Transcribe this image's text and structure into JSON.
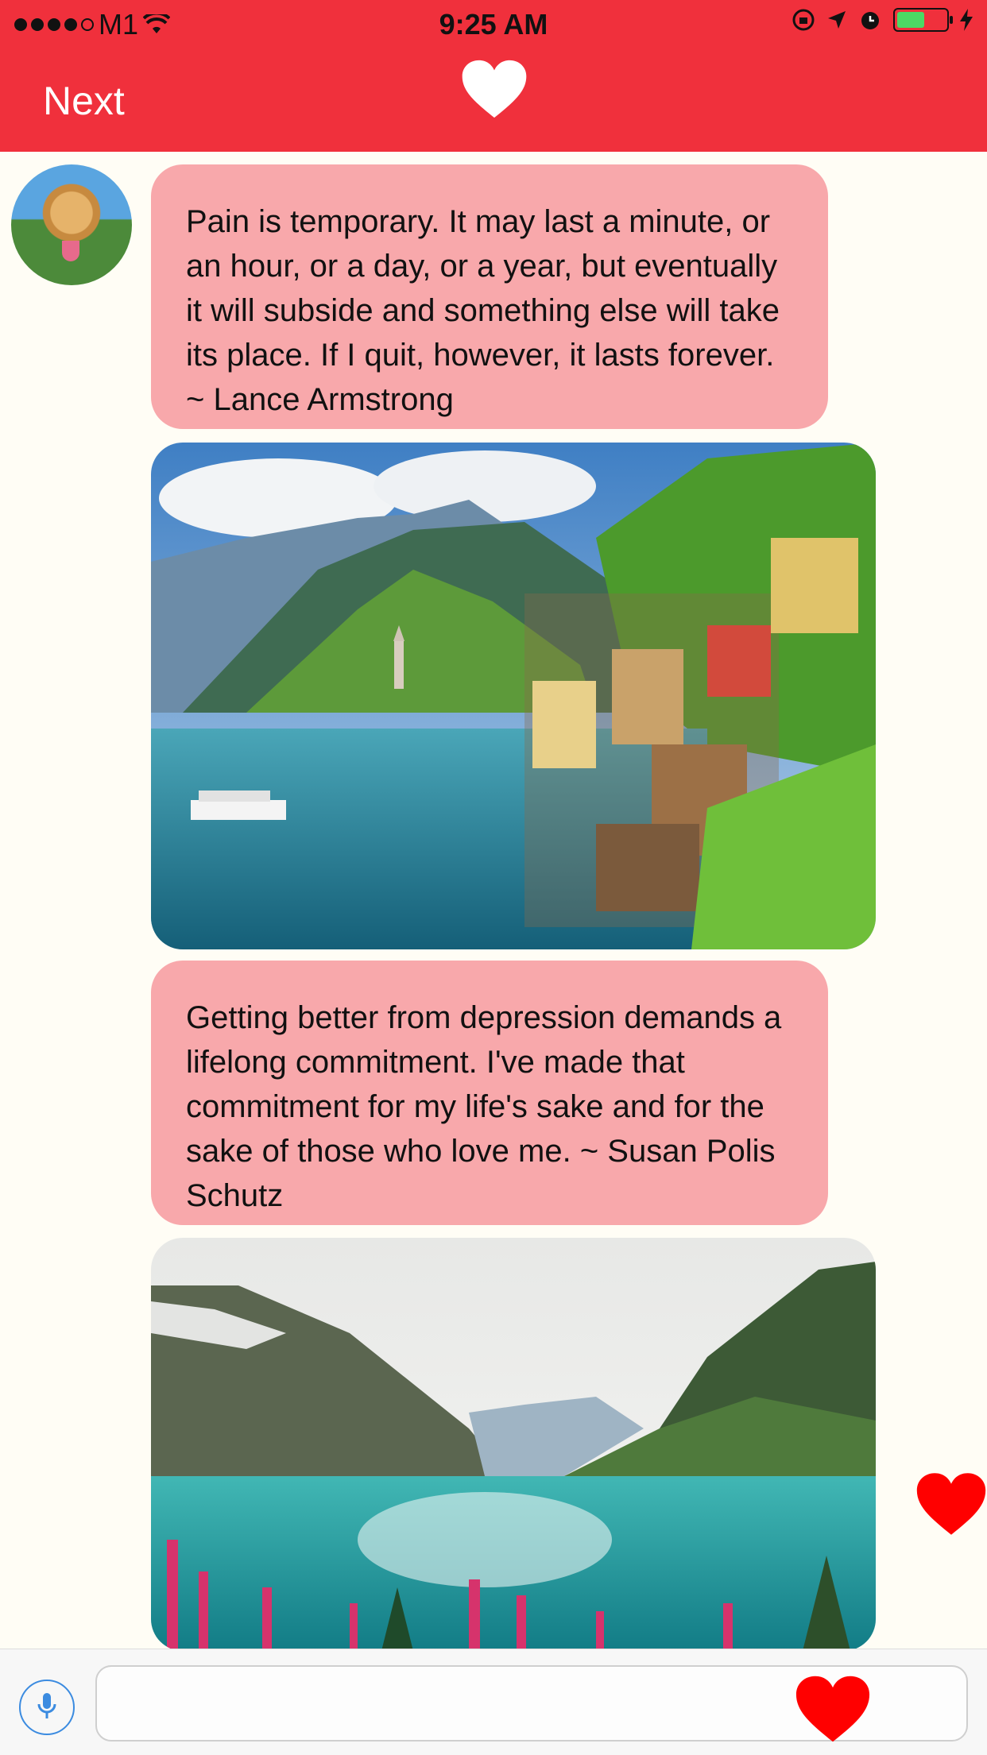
{
  "status_bar": {
    "carrier": "M1",
    "time": "9:25 AM"
  },
  "nav": {
    "next_label": "Next",
    "title_icon": "heart-icon"
  },
  "messages": [
    {
      "type": "text",
      "text": "Pain is temporary. It may last a minute, or an hour, or a day, or a year, but eventually it will subside and something else will take its place. If I quit, however, it lasts forever. ~ Lance Armstrong"
    },
    {
      "type": "image",
      "subject": "lakeside village with mountains"
    },
    {
      "type": "text",
      "text": "Getting better from depression demands a lifelong commitment. I've made that commitment for my life's sake and for the sake of those who love me. ~ Susan Polis Schutz"
    },
    {
      "type": "image",
      "subject": "turquoise mountain lake with pink flowers"
    }
  ],
  "composer": {
    "placeholder": "",
    "mic_icon": "microphone-icon",
    "heart_icon": "heart-icon"
  },
  "colors": {
    "accent": "#f0303c",
    "bubble": "#f8a8ab",
    "background": "#fffdf5",
    "heart": "#ff0000"
  }
}
